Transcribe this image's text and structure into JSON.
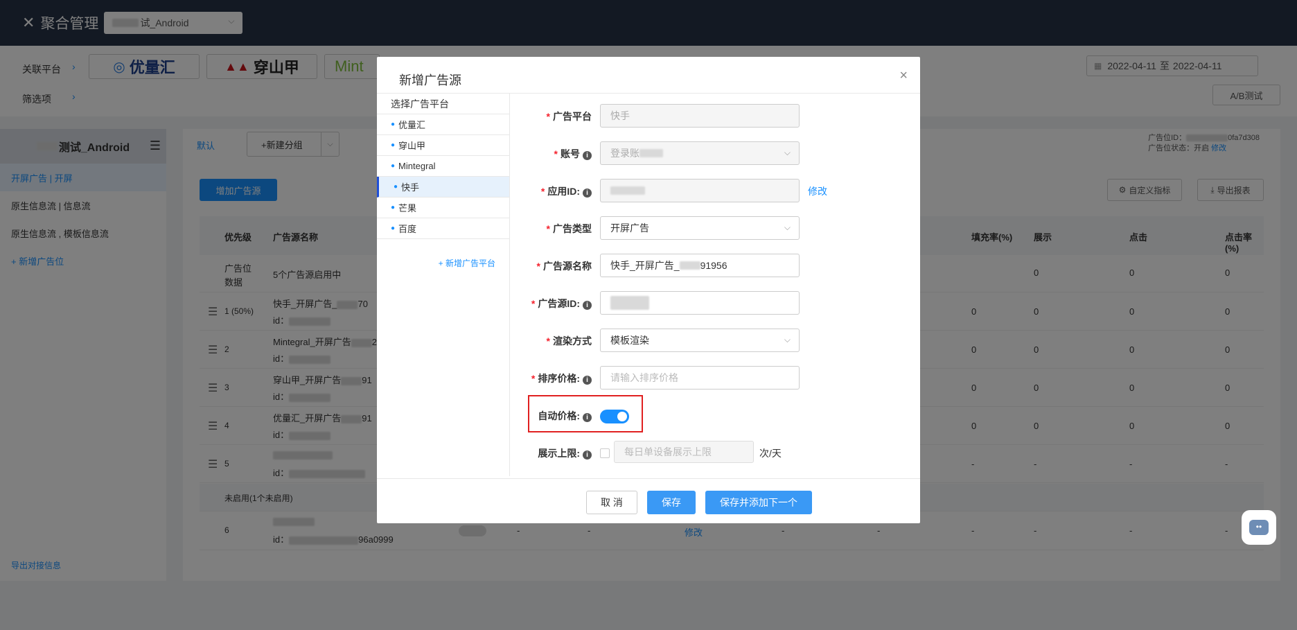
{
  "topbar": {
    "close": "✕",
    "title": "聚合管理",
    "app_select": "试_Android"
  },
  "platform_bar": {
    "label": "关联平台",
    "filter_label": "筛选项",
    "logos": [
      "优量汇",
      "穿山甲",
      "Mint"
    ],
    "date_start": "2022-04-11",
    "date_sep": "至",
    "date_end": "2022-04-11",
    "ab_test": "A/B测试"
  },
  "sidebar": {
    "app_name": "测试_Android",
    "items": [
      "开屏广告 | 开屏",
      "原生信息流 | 信息流",
      "原生信息流 , 模板信息流"
    ],
    "add_slot": "+ 新增广告位",
    "export": "导出对接信息"
  },
  "main": {
    "tab_default": "默认",
    "new_group": "+新建分组",
    "slot_id_label": "广告位ID：",
    "slot_id_value": "0fa7d308",
    "slot_status_label": "广告位状态：",
    "slot_status_value": "开启",
    "slot_status_edit": "修改",
    "add_source": "增加广告源",
    "custom_metrics": "自定义指标",
    "export_report": "导出报表",
    "headers": [
      "优先级",
      "广告源名称",
      "填充率(%)",
      "展示",
      "点击",
      "点击率(%)"
    ],
    "summary_row": {
      "label": "广告位数据",
      "text": "5个广告源启用中",
      "vals": [
        "0",
        "0",
        "0"
      ]
    },
    "rows": [
      {
        "priority": "1 (50%)",
        "name": "快手_开屏广告_",
        "name_tail": "70",
        "id": "id：",
        "vals": [
          "0",
          "0",
          "0",
          "0"
        ]
      },
      {
        "priority": "2",
        "name": "Mintegral_开屏广告",
        "name_tail": "2",
        "id": "id：",
        "vals": [
          "0",
          "0",
          "0",
          "0"
        ]
      },
      {
        "priority": "3",
        "name": "穿山甲_开屏广告",
        "name_tail": "91",
        "id": "id：",
        "vals": [
          "0",
          "0",
          "0",
          "0"
        ]
      },
      {
        "priority": "4",
        "name": "优量汇_开屏广告",
        "name_tail": "91",
        "id": "id：",
        "vals": [
          "0",
          "0",
          "0",
          "0"
        ]
      },
      {
        "priority": "5",
        "name": "",
        "name_tail": "",
        "id": "id：",
        "vals": [
          "-",
          "-",
          "-",
          "-"
        ]
      }
    ],
    "disabled_label": "未启用(1个未启用)",
    "disabled_row": {
      "priority": "6",
      "id": "id：",
      "id_tail": "96a0999",
      "edit": "修改",
      "dashes": [
        "-",
        "-",
        "-",
        "-",
        "-",
        "-",
        "-",
        "-"
      ]
    }
  },
  "modal": {
    "title": "新增广告源",
    "close": "×",
    "platform_header": "选择广告平台",
    "platforms": [
      "优量汇",
      "穿山甲",
      "Mintegral",
      "快手",
      "芒果",
      "百度"
    ],
    "add_platform": "+ 新增广告平台",
    "fields": {
      "platform": {
        "label": "广告平台",
        "value": "快手"
      },
      "account": {
        "label": "账号",
        "value": "登录账"
      },
      "app_id": {
        "label": "应用ID:",
        "link": "修改"
      },
      "ad_type": {
        "label": "广告类型",
        "value": "开屏广告"
      },
      "source_name": {
        "label": "广告源名称",
        "value_prefix": "快手_开屏广告_",
        "value_suffix": "91956"
      },
      "source_id": {
        "label": "广告源ID:"
      },
      "render": {
        "label": "渲染方式",
        "value": "模板渲染"
      },
      "sort_price": {
        "label": "排序价格:",
        "placeholder": "请输入排序价格"
      },
      "auto_price": {
        "label": "自动价格:",
        "enabled": true
      },
      "display_limit": {
        "label": "展示上限:",
        "placeholder": "每日单设备展示上限",
        "unit": "次/天"
      }
    },
    "buttons": {
      "cancel": "取 消",
      "save": "保存",
      "save_next": "保存并添加下一个"
    }
  },
  "colors": {
    "accent": "#1890ff",
    "topbar": "#273246",
    "highlight": "#e02020"
  }
}
